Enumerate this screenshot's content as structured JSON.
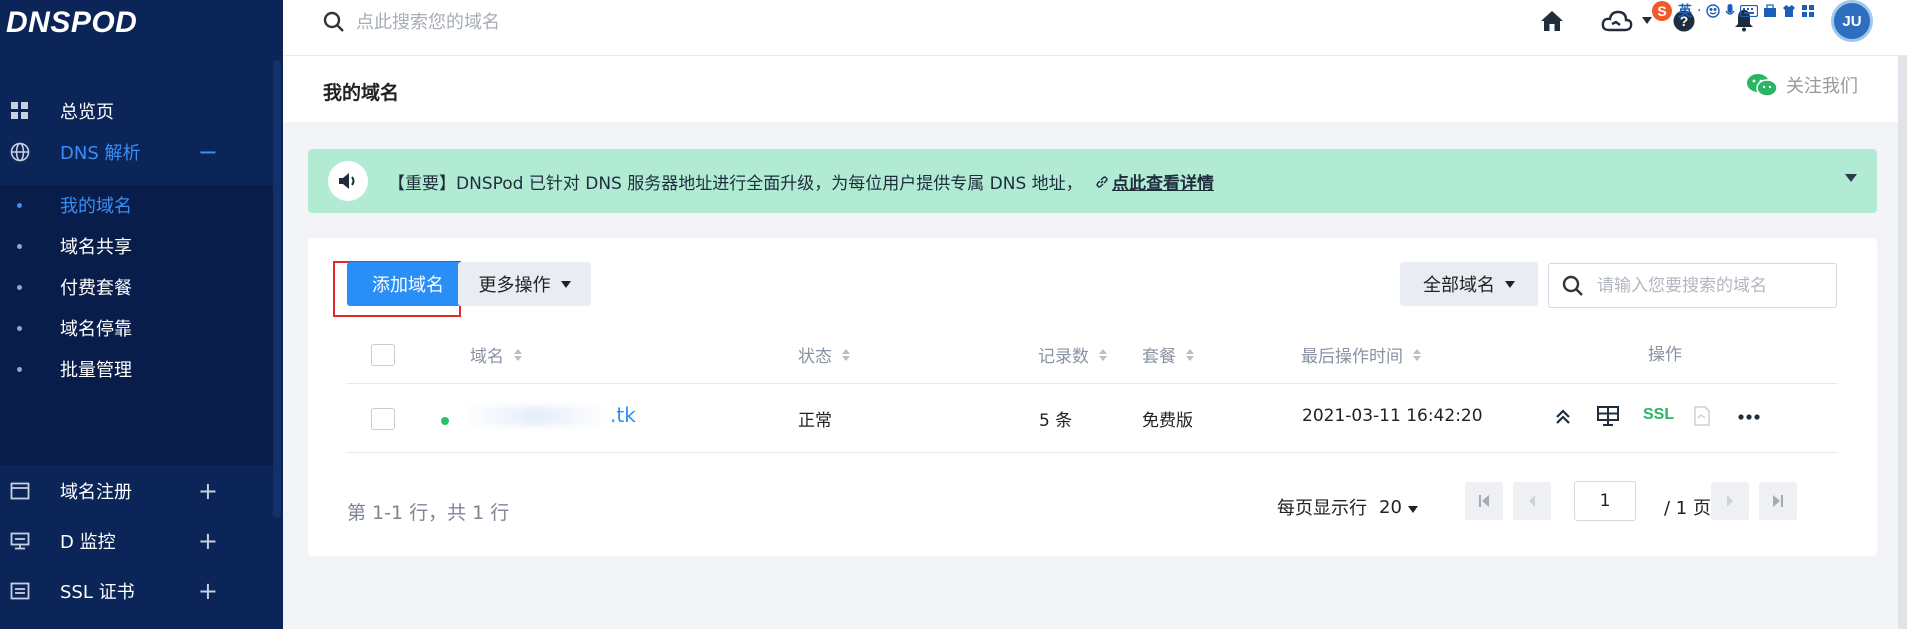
{
  "brand": {
    "logo": "DNSPOD"
  },
  "sidebar": {
    "items": [
      {
        "label": "总览页",
        "sign": ""
      },
      {
        "label": "DNS 解析",
        "sign": "−"
      },
      {
        "label": "域名注册",
        "sign": "+"
      },
      {
        "label": "D 监控",
        "sign": "+"
      },
      {
        "label": "SSL 证书",
        "sign": "+"
      }
    ],
    "subitems": [
      {
        "label": "我的域名"
      },
      {
        "label": "域名共享"
      },
      {
        "label": "付费套餐"
      },
      {
        "label": "域名停靠"
      },
      {
        "label": "批量管理"
      }
    ]
  },
  "topbar": {
    "search_placeholder": "点此搜索您的域名",
    "avatar_text": "JU",
    "ime": {
      "lang": "英"
    }
  },
  "page": {
    "title": "我的域名",
    "follow_label": "关注我们"
  },
  "notice": {
    "text": "【重要】DNSPod 已针对 DNS 服务器地址进行全面升级，为每位用户提供专属 DNS 地址，",
    "link": "点此查看详情"
  },
  "toolbar": {
    "add_domain": "添加域名",
    "more_actions": "更多操作",
    "all_domains": "全部域名",
    "search_placeholder": "请输入您要搜索的域名"
  },
  "table": {
    "headers": {
      "domain": "域名",
      "status": "状态",
      "records": "记录数",
      "plan": "套餐",
      "last_op": "最后操作时间",
      "actions": "操作"
    },
    "rows": [
      {
        "domain": ".tk",
        "status": "正常",
        "records": "5 条",
        "plan": "免费版",
        "last_op": "2021-03-11 16:42:20",
        "ssl": "SSL"
      }
    ]
  },
  "footer": {
    "summary": "第 1-1 行，共 1 行",
    "per_page_label": "每页显示行",
    "per_page_value": "20",
    "page_input": "1",
    "page_total": "/ 1 页"
  },
  "colors": {
    "sidebar_bg": "#0b2559",
    "accent": "#2a8ef7",
    "notice_bg": "#b1ebd3",
    "ok_green": "#29c26b"
  }
}
